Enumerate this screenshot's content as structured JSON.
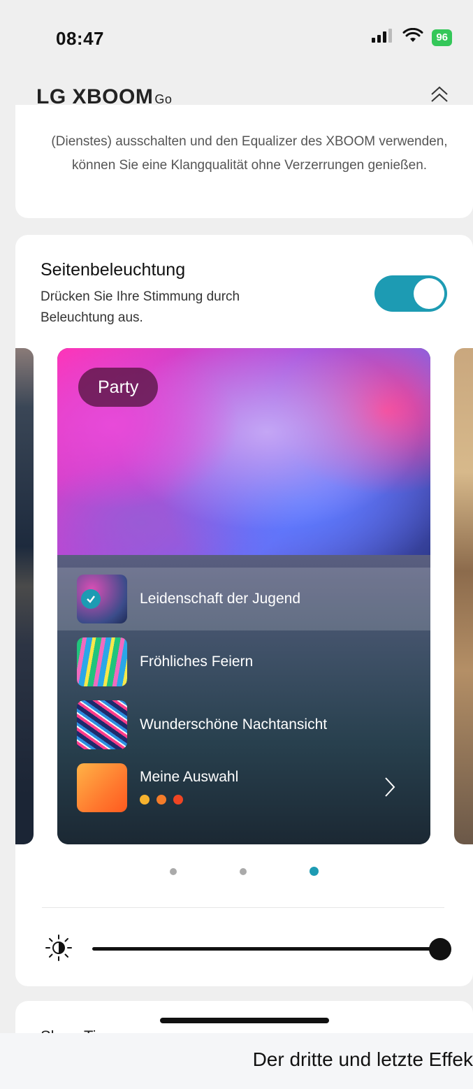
{
  "status_bar": {
    "time": "08:47",
    "battery": "96"
  },
  "app_bar": {
    "brand": "LG XBOOM",
    "brand_suffix": "Go"
  },
  "intro_text": "(Dienstes) ausschalten und den Equalizer des XBOOM verwenden, können Sie eine Klangqualität ohne Verzerrungen genießen.",
  "lighting": {
    "title": "Seitenbeleuchtung",
    "description": "Drücken Sie Ihre Stimmung durch Beleuchtung aus.",
    "enabled": true
  },
  "carousel": {
    "category": "Party",
    "items": [
      {
        "label": "Leidenschaft der Jugend",
        "selected": true
      },
      {
        "label": "Fröhliches Feiern",
        "selected": false
      },
      {
        "label": "Wunderschöne Nachtansicht",
        "selected": false
      },
      {
        "label": "Meine Auswahl",
        "selected": false,
        "dots": [
          "#f7b22e",
          "#f47c2a",
          "#f04523"
        ]
      }
    ],
    "page_count": 3,
    "active_page": 3
  },
  "brightness": {
    "level": 1.0
  },
  "next_section_peek": "Sleep Timer",
  "caption": "Der dritte und letzte Effek",
  "colors": {
    "accent": "#1d9bb3"
  }
}
